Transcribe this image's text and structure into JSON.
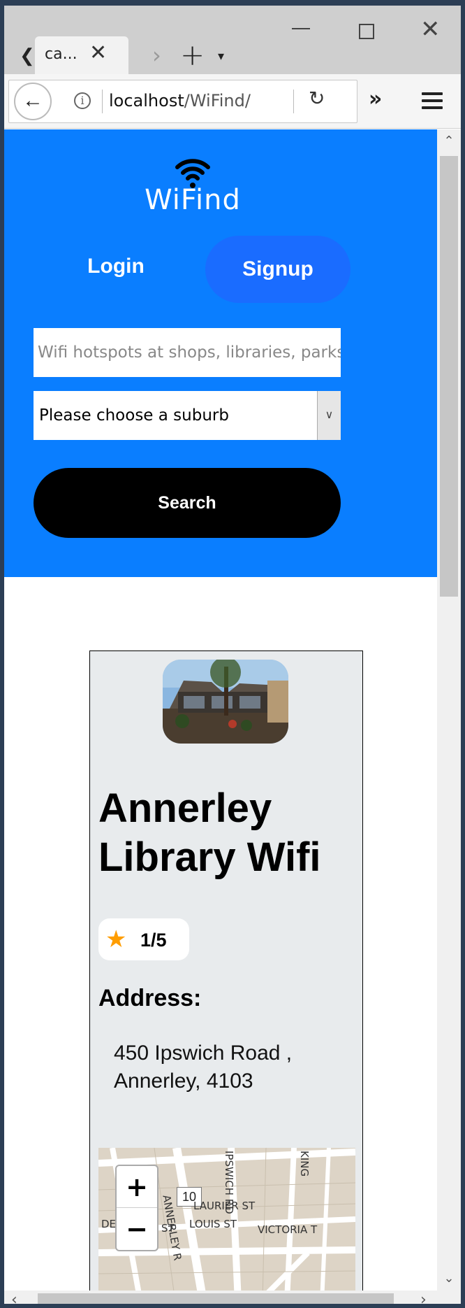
{
  "browser": {
    "tab_title": "ca...",
    "url_host": "localhost",
    "url_path": "/WiFind/"
  },
  "header": {
    "logo_text": "WiFind",
    "login_label": "Login",
    "signup_label": "Signup"
  },
  "search": {
    "placeholder": "Wifi hotspots at shops, libraries, parks",
    "suburb_selected": "Please choose a suburb",
    "button_label": "Search"
  },
  "result": {
    "title": "Annerley Library Wifi",
    "rating": "1/5",
    "address_heading": "Address:",
    "address": "450 Ipswich Road , Annerley, 4103"
  },
  "map": {
    "zoom_in_label": "+",
    "zoom_out_label": "−",
    "route_label": "10",
    "streets": [
      "IPSWICH RD",
      "LAURIER ST",
      "LOUIS ST",
      "VICTORIA T",
      "ANNERLEY R",
      "KING",
      "DE",
      "ST"
    ]
  },
  "colors": {
    "hero": "#0a7eff",
    "signup": "#1a6cff",
    "card": "#e8ebed",
    "star": "#ff9d00"
  }
}
